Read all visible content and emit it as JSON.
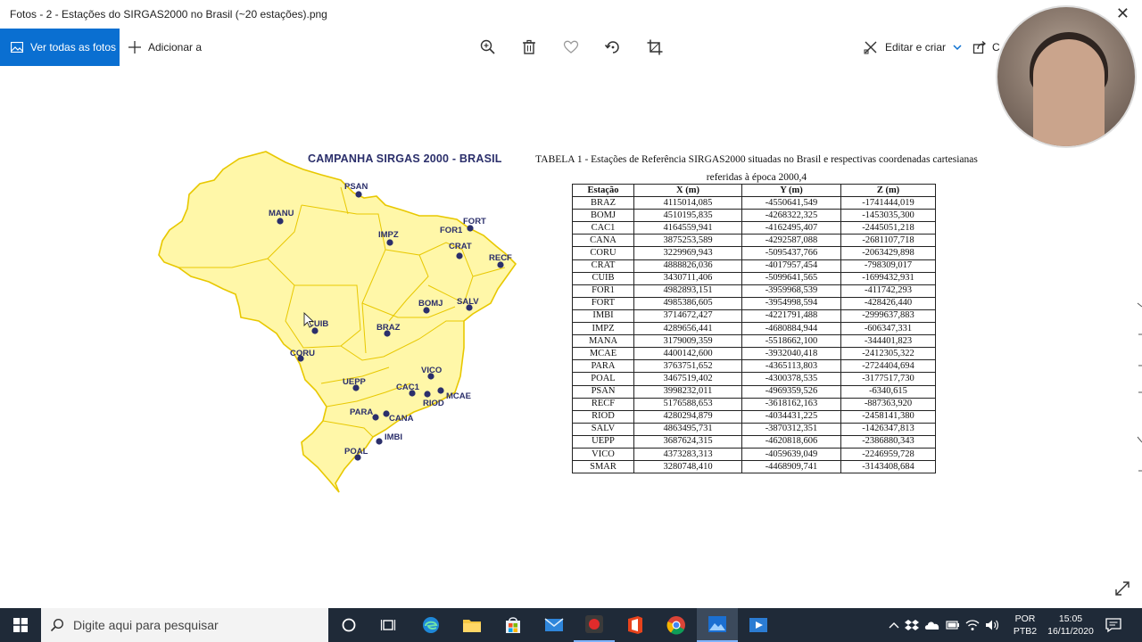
{
  "window": {
    "title": "Fotos - 2 - Estações do SIRGAS2000 no Brasil (~20 estações).png",
    "close_glyph": "✕"
  },
  "toolbar": {
    "see_all_label": "Ver todas as fotos",
    "add_label": "Adicionar a",
    "edit_label": "Editar e criar",
    "share_label": "C",
    "icons": [
      "zoom-in-icon",
      "delete-icon",
      "favorite-icon",
      "rotate-icon",
      "crop-icon"
    ]
  },
  "figure": {
    "map_title": "CAMPANHA SIRGAS 2000 - BRASIL",
    "stations": [
      "PSAN",
      "MANU",
      "IMPZ",
      "FORT",
      "FOR1",
      "CRAT",
      "RECF",
      "BOMJ",
      "SALV",
      "CUIB",
      "BRAZ",
      "CORU",
      "UEPP",
      "VICO",
      "CAC1",
      "MCAE",
      "RIOD",
      "PARA",
      "CANA",
      "IMBI",
      "POAL"
    ],
    "table_caption_line1": "TABELA 1 - Estações de Referência SIRGAS2000 situadas no Brasil e respectivas coordenadas cartesianas",
    "table_caption_line2": "referidas à época 2000,4",
    "table": {
      "headers": [
        "Estação",
        "X (m)",
        "Y (m)",
        "Z (m)"
      ],
      "rows": [
        [
          "BRAZ",
          "4115014,085",
          "-4550641,549",
          "-1741444,019"
        ],
        [
          "BOMJ",
          "4510195,835",
          "-4268322,325",
          "-1453035,300"
        ],
        [
          "CAC1",
          "4164559,941",
          "-4162495,407",
          "-2445051,218"
        ],
        [
          "CANA",
          "3875253,589",
          "-4292587,088",
          "-2681107,718"
        ],
        [
          "CORU",
          "3229969,943",
          "-5095437,766",
          "-2063429,898"
        ],
        [
          "CRAT",
          "4888826,036",
          "-4017957,454",
          "-798309,017"
        ],
        [
          "CUIB",
          "3430711,406",
          "-5099641,565",
          "-1699432,931"
        ],
        [
          "FOR1",
          "4982893,151",
          "-3959968,539",
          "-411742,293"
        ],
        [
          "FORT",
          "4985386,605",
          "-3954998,594",
          "-428426,440"
        ],
        [
          "IMBI",
          "3714672,427",
          "-4221791,488",
          "-2999637,883"
        ],
        [
          "IMPZ",
          "4289656,441",
          "-4680884,944",
          "-606347,331"
        ],
        [
          "MANA",
          "3179009,359",
          "-5518662,100",
          "-344401,823"
        ],
        [
          "MCAE",
          "4400142,600",
          "-3932040,418",
          "-2412305,322"
        ],
        [
          "PARA",
          "3763751,652",
          "-4365113,803",
          "-2724404,694"
        ],
        [
          "POAL",
          "3467519,402",
          "-4300378,535",
          "-3177517,730"
        ],
        [
          "PSAN",
          "3998232,011",
          "-4969359,526",
          "-6340,615"
        ],
        [
          "RECF",
          "5176588,653",
          "-3618162,163",
          "-887363,920"
        ],
        [
          "RIOD",
          "4280294,879",
          "-4034431,225",
          "-2458141,380"
        ],
        [
          "SALV",
          "4863495,731",
          "-3870312,351",
          "-1426347,813"
        ],
        [
          "UEPP",
          "3687624,315",
          "-4620818,606",
          "-2386880,343"
        ],
        [
          "VICO",
          "4373283,313",
          "-4059639,049",
          "-2246959,728"
        ],
        [
          "SMAR",
          "3280748,410",
          "-4468909,741",
          "-3143408,684"
        ]
      ]
    }
  },
  "taskbar": {
    "search_placeholder": "Digite aqui para pesquisar",
    "apps": [
      "cortana-icon",
      "task-view-icon",
      "edge-icon",
      "file-explorer-icon",
      "store-icon",
      "mail-icon",
      "recorder-icon",
      "office-icon",
      "chrome-icon",
      "photos-icon",
      "video-editor-icon"
    ],
    "language_top": "POR",
    "language_bottom": "PTB2",
    "time": "15:05",
    "date": "16/11/2020"
  },
  "colors": {
    "accent": "#0a6fd1",
    "map_fill": "#fff7a8",
    "map_border": "#e8c800",
    "station": "#2b2f6b",
    "taskbar": "#1f2a38"
  }
}
